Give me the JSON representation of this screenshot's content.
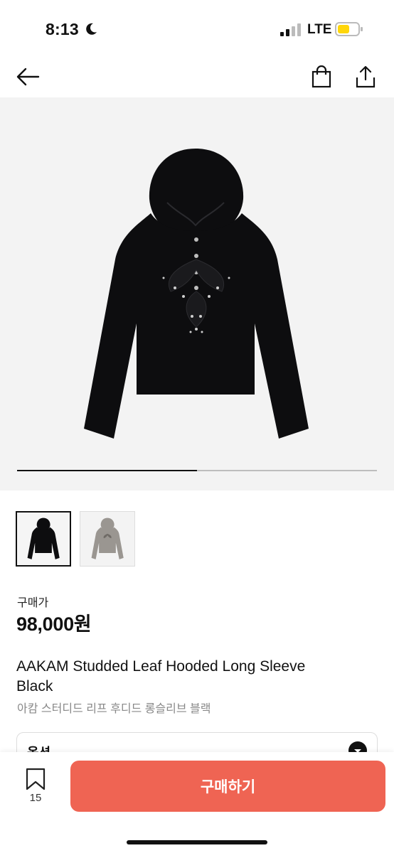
{
  "status_bar": {
    "time": "8:13",
    "network": "LTE"
  },
  "nav": {
    "back_icon": "arrow-left-icon",
    "bag_icon": "shopping-bag-icon",
    "share_icon": "share-icon"
  },
  "gallery": {
    "image_count": 2,
    "current_index": 1,
    "progress_fraction": 0.5
  },
  "product": {
    "price_label": "구매가",
    "price": "98,000원",
    "title_en": "AAKAM Studded Leaf Hooded Long Sleeve Black",
    "title_ko": "아캄 스터디드 리프 후디드 롱슬리브 블랙"
  },
  "option": {
    "label": "옵션"
  },
  "bottom_bar": {
    "bookmark_count": "15",
    "buy_label": "구매하기"
  },
  "colors": {
    "accent": "#ef6453",
    "hero_bg": "#f3f3f3"
  }
}
